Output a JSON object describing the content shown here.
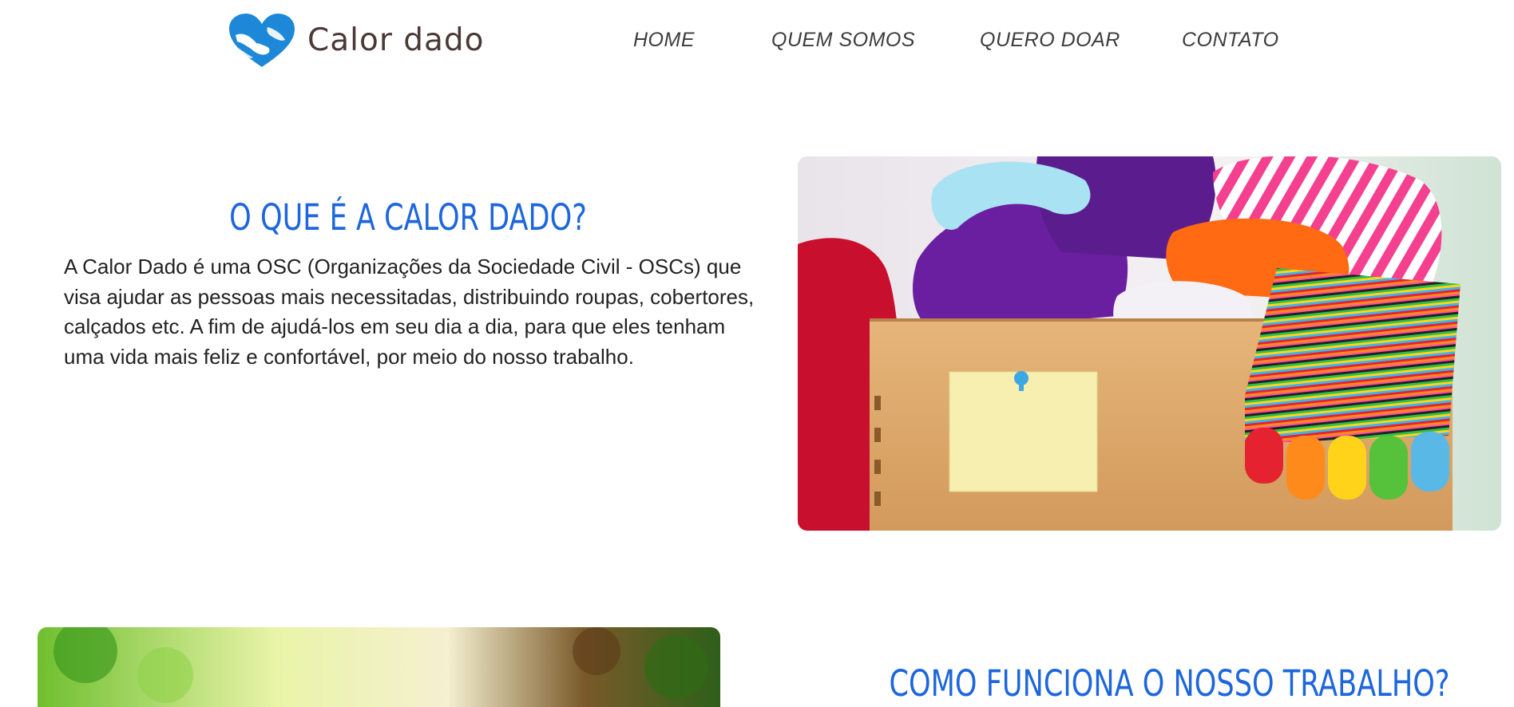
{
  "brand": {
    "name": "Calor dado",
    "logo_icon": "heart-hands-icon",
    "logo_color": "#1e88d8"
  },
  "nav": {
    "items": [
      {
        "label": "HOME"
      },
      {
        "label": "QUEM SOMOS"
      },
      {
        "label": "QUERO DOAR"
      },
      {
        "label": "CONTATO"
      }
    ]
  },
  "about": {
    "title": "O QUE É A CALOR DADO?",
    "text": "A Calor Dado é uma OSC (Organizações da Sociedade Civil - OSCs) que visa ajudar as pessoas mais necessitadas, distribuindo roupas, cobertores, calçados etc. A fim de ajudá-los em seu dia a dia, para que eles tenham uma vida mais feliz e confortável, por meio do nosso trabalho.",
    "image_icon": "clothes-box-photo"
  },
  "how_it_works": {
    "title": "COMO FUNCIONA O NOSSO TRABALHO?",
    "image_icon": "garden-photo"
  },
  "colors": {
    "heading": "#1d66dc",
    "body_text": "#222222",
    "nav_text": "#3d3d3d",
    "brand_text": "#4a3a37"
  }
}
